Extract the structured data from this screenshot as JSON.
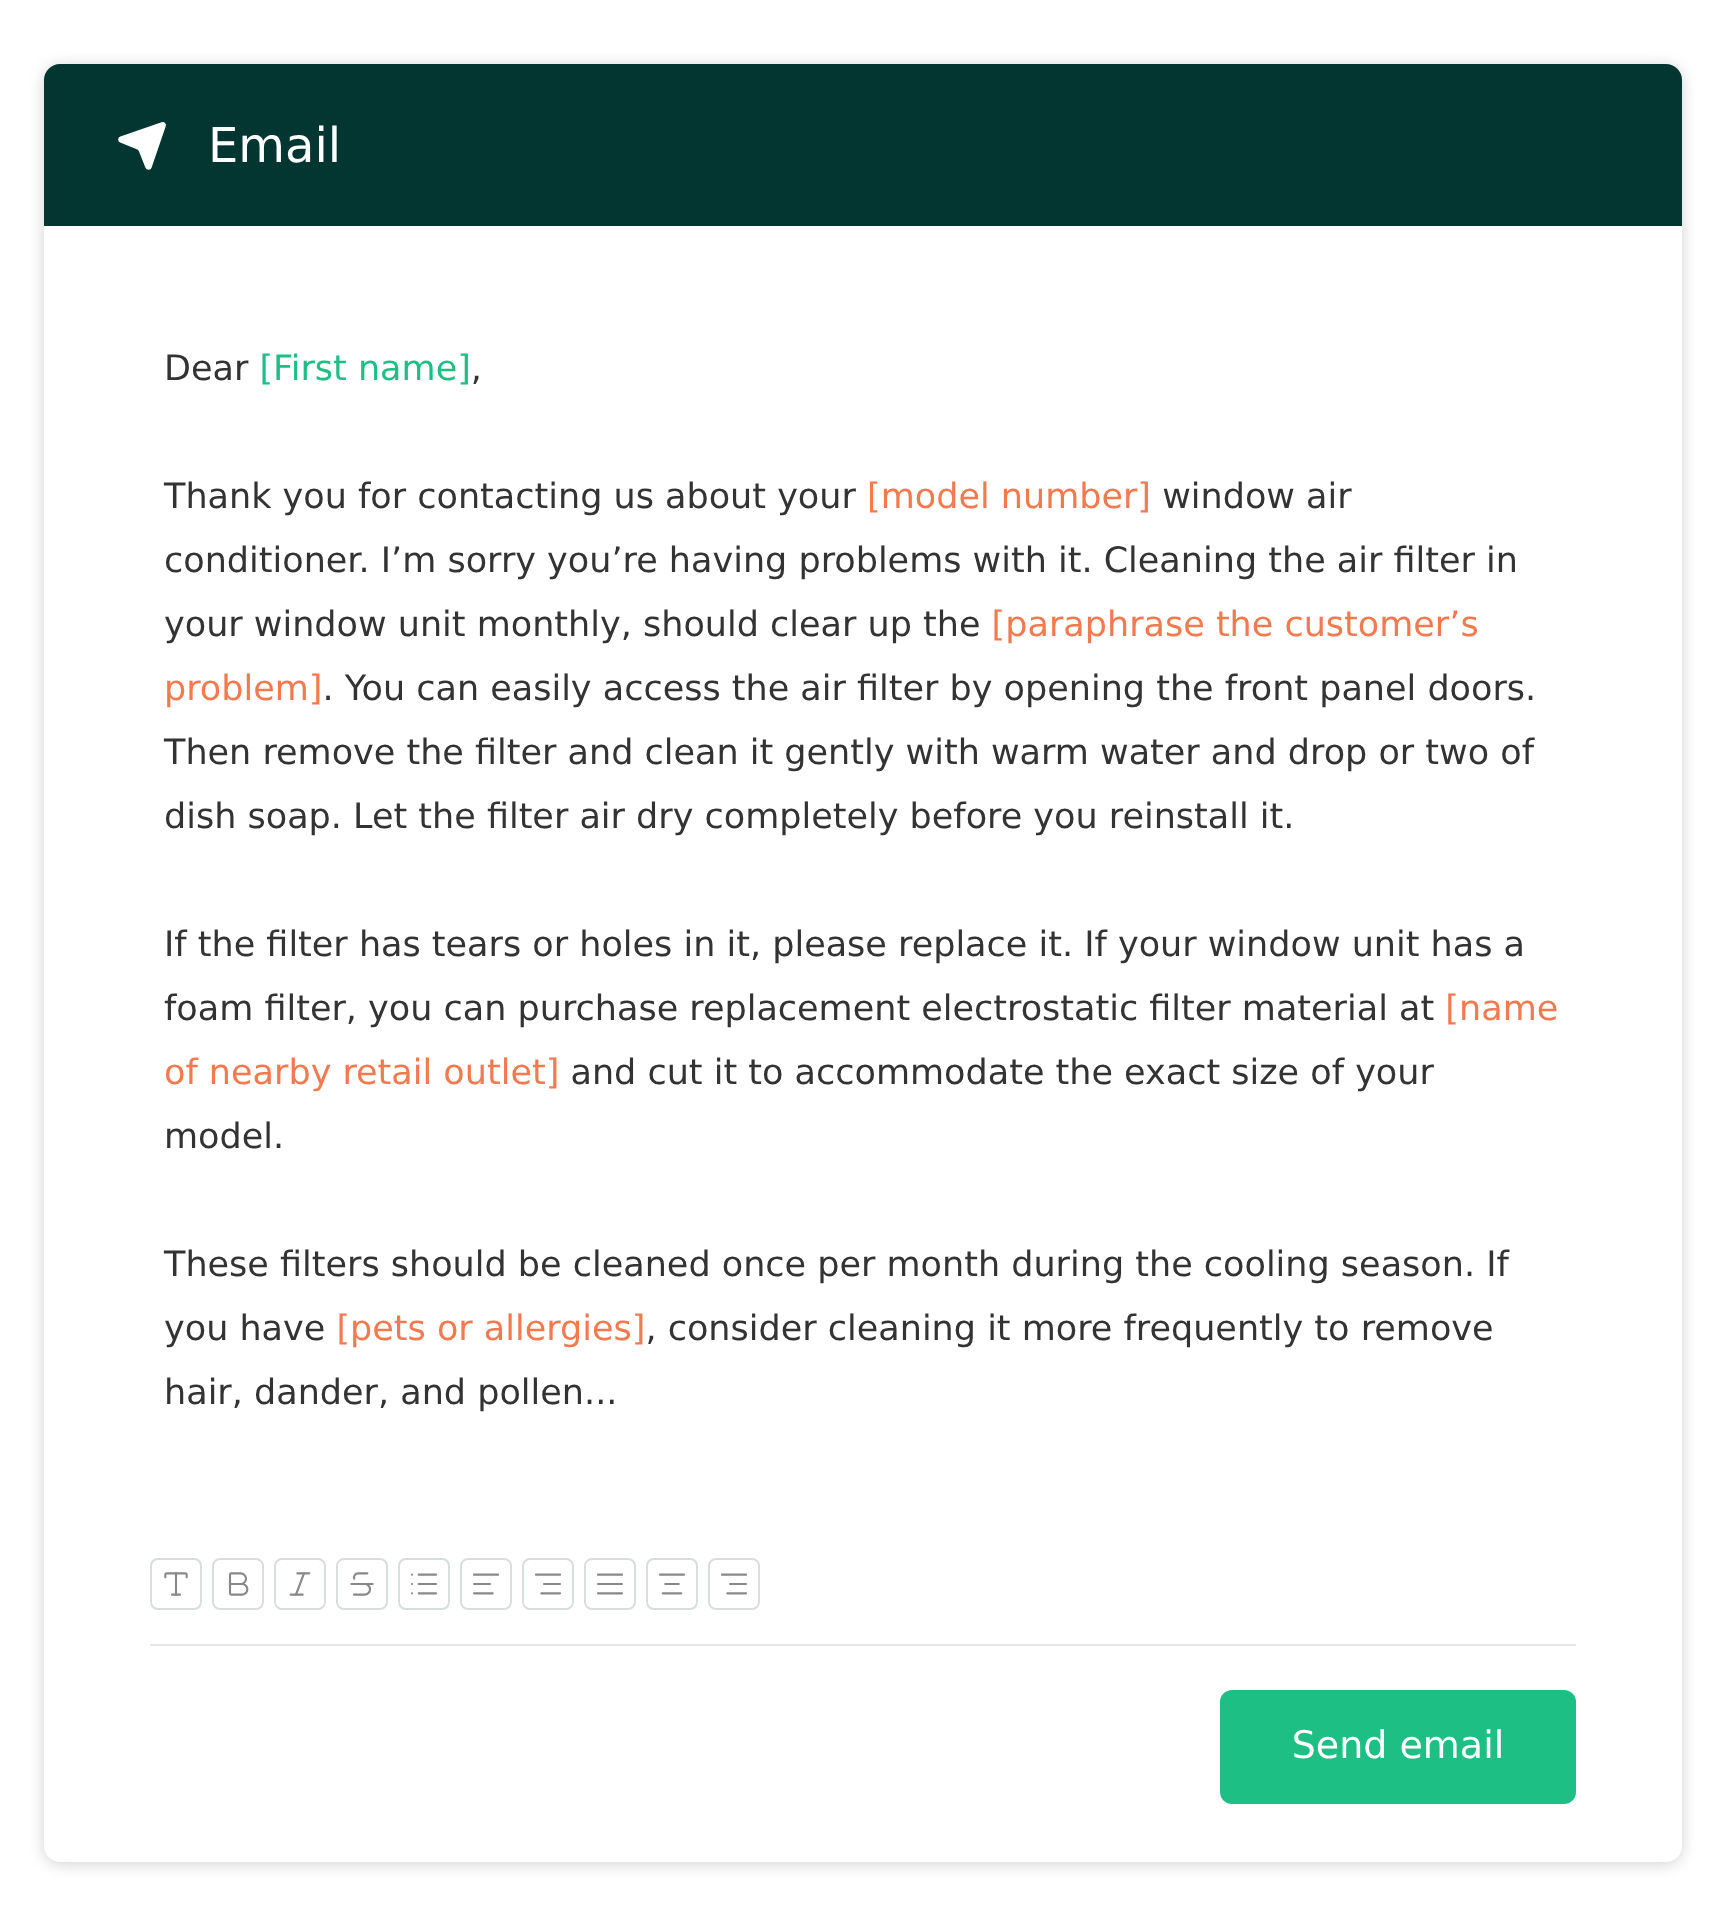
{
  "header": {
    "title": "Email"
  },
  "paragraphs": [
    [
      {
        "kind": "plain",
        "text": "Dear "
      },
      {
        "kind": "name",
        "text": "[First name]"
      },
      {
        "kind": "plain",
        "text": ","
      }
    ],
    [
      {
        "kind": "plain",
        "text": "Thank you for contacting us about your "
      },
      {
        "kind": "hint",
        "text": "[model number]"
      },
      {
        "kind": "plain",
        "text": " window air conditioner. I’m sorry you’re having problems with it. Cleaning the air filter in your window unit monthly, should clear up the "
      },
      {
        "kind": "hint",
        "text": "[paraphrase the customer’s problem]"
      },
      {
        "kind": "plain",
        "text": ". You can easily access the air filter by opening the front panel doors. Then remove the filter and clean it gently with warm water and drop or two of dish soap. Let the filter air dry completely before you reinstall it."
      }
    ],
    [
      {
        "kind": "plain",
        "text": "If the filter has tears or holes in it, please replace it. If your window unit has a foam filter, you can purchase replacement electrostatic filter material at "
      },
      {
        "kind": "hint",
        "text": "[name of nearby retail outlet]"
      },
      {
        "kind": "plain",
        "text": " and cut it to accommodate the exact size of your model."
      }
    ],
    [
      {
        "kind": "plain",
        "text": "These filters should be cleaned once per month during the cooling season. If you have "
      },
      {
        "kind": "hint",
        "text": "[pets or allergies]"
      },
      {
        "kind": "plain",
        "text": ", consider cleaning it more frequently to remove hair, dander, and pollen..."
      }
    ]
  ],
  "toolbar": [
    {
      "kind": "text"
    },
    {
      "kind": "bold"
    },
    {
      "kind": "italic"
    },
    {
      "kind": "strike"
    },
    {
      "kind": "list"
    },
    {
      "kind": "align-left"
    },
    {
      "kind": "align-right"
    },
    {
      "kind": "justify"
    },
    {
      "kind": "align-center"
    },
    {
      "kind": "align-right-short"
    }
  ],
  "send_button": {
    "label": "Send email"
  }
}
